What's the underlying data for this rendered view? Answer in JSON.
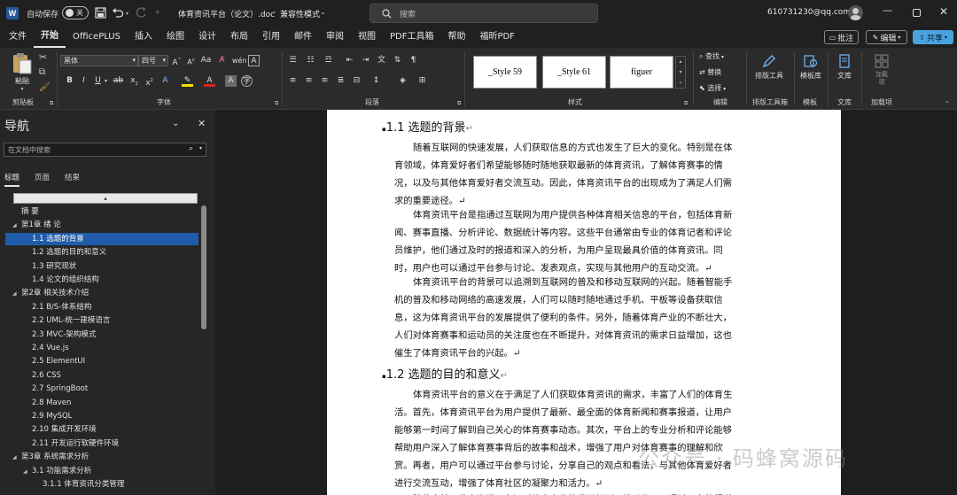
{
  "titlebar": {
    "autosave_label": "自动保存",
    "autosave_state": "关",
    "doc_title": "体育资讯平台（论文）.doc",
    "compat_mode": "兼容性模式",
    "search_placeholder": "搜索",
    "account": "610731230@qq.com"
  },
  "menu": {
    "tabs": [
      "文件",
      "开始",
      "OfficePLUS",
      "插入",
      "绘图",
      "设计",
      "布局",
      "引用",
      "邮件",
      "审阅",
      "视图",
      "PDF工具箱",
      "帮助",
      "福昕PDF"
    ],
    "comment_btn": "批注",
    "edit_btn": "编辑",
    "share_btn": "共享"
  },
  "ribbon": {
    "clipboard": {
      "paste": "粘贴",
      "label": "剪贴板"
    },
    "font": {
      "name": "黑体",
      "size": "四号",
      "label": "字体"
    },
    "paragraph": {
      "label": "段落"
    },
    "styles": {
      "items": [
        "_Style 59",
        "_Style 61",
        "figuer"
      ],
      "label": "样式"
    },
    "editing": {
      "find": "查找",
      "replace": "替换",
      "select": "选择",
      "label": "编辑"
    },
    "layout_tools": {
      "btn": "排版工具",
      "label": "排版工具箱"
    },
    "template": {
      "btn": "模板库",
      "label": "模板"
    },
    "library": {
      "btn": "文库",
      "label": "文库"
    },
    "addins": {
      "btn": "加载项",
      "label": "加载项"
    }
  },
  "nav": {
    "title": "导航",
    "search_placeholder": "在文档中搜索",
    "tabs": [
      "标题",
      "页面",
      "结果"
    ],
    "items": [
      {
        "text": "摘 要",
        "level": 1,
        "caret": false,
        "selected": false
      },
      {
        "text": "第1章 绪 论",
        "level": 1,
        "caret": true,
        "selected": false
      },
      {
        "text": "1.1 选题的背景",
        "level": 2,
        "caret": false,
        "selected": true
      },
      {
        "text": "1.2 选题的目的和意义",
        "level": 2,
        "caret": false,
        "selected": false
      },
      {
        "text": "1.3 研究现状",
        "level": 2,
        "caret": false,
        "selected": false
      },
      {
        "text": "1.4 论文的组织结构",
        "level": 2,
        "caret": false,
        "selected": false
      },
      {
        "text": "第2章 相关技术介绍",
        "level": 1,
        "caret": true,
        "selected": false
      },
      {
        "text": "2.1 B/S-体系结构",
        "level": 2,
        "caret": false,
        "selected": false
      },
      {
        "text": "2.2 UML-统一建模语言",
        "level": 2,
        "caret": false,
        "selected": false
      },
      {
        "text": "2.3 MVC-架构模式",
        "level": 2,
        "caret": false,
        "selected": false
      },
      {
        "text": "2.4 Vue.js",
        "level": 2,
        "caret": false,
        "selected": false
      },
      {
        "text": "2.5 ElementUI",
        "level": 2,
        "caret": false,
        "selected": false
      },
      {
        "text": "2.6 CSS",
        "level": 2,
        "caret": false,
        "selected": false
      },
      {
        "text": "2.7 SpringBoot",
        "level": 2,
        "caret": false,
        "selected": false
      },
      {
        "text": "2.8 Maven",
        "level": 2,
        "caret": false,
        "selected": false
      },
      {
        "text": "2.9 MySQL",
        "level": 2,
        "caret": false,
        "selected": false
      },
      {
        "text": "2.10 集成开发环境",
        "level": 2,
        "caret": false,
        "selected": false
      },
      {
        "text": "2.11 开发运行软硬件环境",
        "level": 2,
        "caret": false,
        "selected": false
      },
      {
        "text": "第3章 系统需求分析",
        "level": 1,
        "caret": true,
        "selected": false
      },
      {
        "text": "3.1 功能需求分析",
        "level": 2,
        "caret": true,
        "selected": false
      },
      {
        "text": "3.1.1 体育资讯分类管理",
        "level": 3,
        "caret": false,
        "selected": false
      }
    ]
  },
  "doc": {
    "h1": "1.1   选题的背景",
    "p1": [
      "随着互联网的快速发展，人们获取信息的方式也发生了巨大的变化。特别是在体",
      "育领域，体育爱好者们希望能够随时随地获取最新的体育资讯，了解体育赛事的情",
      "况，以及与其他体育爱好者交流互动。因此，体育资讯平台的出现成为了满足人们需",
      "求的重要途径。↵"
    ],
    "p2": [
      "体育资讯平台是指通过互联网为用户提供各种体育相关信息的平台，包括体育新",
      "闻、赛事直播、分析评论、数据统计等内容。这些平台通常由专业的体育记者和评论",
      "员维护，他们通过及时的报道和深入的分析，为用户呈现最具价值的体育资讯。同",
      "时，用户也可以通过平台参与讨论、发表观点，实现与其他用户的互动交流。↵"
    ],
    "p3": [
      "体育资讯平台的背景可以追溯到互联网的普及和移动互联网的兴起。随着智能手",
      "机的普及和移动网络的高速发展，人们可以随时随地通过手机、平板等设备获取信",
      "息，这为体育资讯平台的发展提供了便利的条件。另外，随着体育产业的不断壮大，",
      "人们对体育赛事和运动员的关注度也在不断提升，对体育资讯的需求日益增加，这也",
      "催生了体育资讯平台的兴起。↵"
    ],
    "h2": "1.2   选题的目的和意义",
    "p4": [
      "体育资讯平台的意义在于满足了人们获取体育资讯的需求，丰富了人们的体育生",
      "活。首先，体育资讯平台为用户提供了最新、最全面的体育新闻和赛事报道，让用户",
      "能够第一时间了解到自己关心的体育赛事动态。其次，平台上的专业分析和评论能够",
      "帮助用户深入了解体育赛事背后的故事和战术，增强了用户对体育赛事的理解和欣",
      "赏。再者，用户可以通过平台参与讨论，分享自己的观点和看法，与其他体育爱好者",
      "进行交流互动，增强了体育社区的凝聚力和活力。↵"
    ],
    "p5_partial": "除此之外，体育资讯平台还对体育产业的发展起到了推动作用。通过平台的报道"
  },
  "watermark": "公众号 · 码蜂窝源码"
}
